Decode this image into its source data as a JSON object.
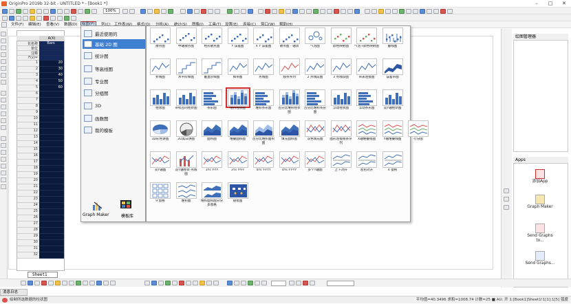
{
  "window": {
    "title": "OriginPro 2019b 32-bit - UNTITLED * - [Book1 *]"
  },
  "toolbar": {
    "zoom_value": "100%"
  },
  "menubar": {
    "items": [
      "文件(F)",
      "编辑(E)",
      "查看(V)",
      "数据(D)",
      "绘图(P)",
      "列(C)",
      "工作表(W)",
      "格式(O)",
      "分析(A)",
      "统计(S)",
      "图像(I)",
      "工具(T)",
      "设置(E)",
      "连接(C)",
      "窗口(W)",
      "帮助(H)"
    ]
  },
  "book": {
    "col_header": "A(X)",
    "row_labels": [
      "长名称",
      "单位",
      "注释",
      "F(x)="
    ],
    "first_cell": "Bars",
    "row_numbers": [
      "1",
      "2",
      "3",
      "4",
      "5",
      "6",
      "7",
      "8",
      "9",
      "10",
      "11",
      "12",
      "13",
      "14",
      "15",
      "16",
      "17",
      "18",
      "19",
      "20",
      "21",
      "22",
      "23",
      "24",
      "25",
      "26",
      "27",
      "28",
      "29",
      "30",
      "31",
      "32"
    ],
    "values": [
      "20",
      "30",
      "40",
      "50",
      "60"
    ]
  },
  "plot_menu": {
    "categories": [
      "最近使用的",
      "基础 2D 图",
      "统计图",
      "等高线图",
      "专业图",
      "分组图",
      "3D",
      "函数图",
      "我的模板"
    ],
    "selected": "基础 2D 图",
    "bottom": {
      "graph_maker": "Graph Maker",
      "templates": "模板库"
    }
  },
  "gallery": {
    "rows": [
      [
        "散点图",
        "中轴散点图",
        "柱形散点图",
        "Y 误差图",
        "X Y 误差图",
        "散点图 - 轴须",
        "气泡图",
        "颜色映射图",
        "气泡+颜色映射图",
        "垂线图"
      ],
      [
        "折线图",
        "水平阶梯图",
        "垂直阶梯图",
        "样条图",
        "点线图",
        "线条序列",
        "2 点线段图",
        "3 点线段图",
        "带表连接图",
        "误差带图"
      ],
      [
        "柱状图",
        "带标签的柱状图",
        "条形图",
        "堆积柱状图",
        "堆积条形图",
        "百分比堆积柱状图",
        "百分比堆积条形图",
        "浮动柱状图",
        "浮动条形图",
        "双Y轴柱状图"
      ],
      [
        "3D彩色饼图",
        "2D黑白饼图",
        "面积图",
        "堆叠面积图",
        "百分比堆积面积图",
        "填充面积图",
        "双色填充图",
        "图形连接线条序列",
        "X轴堆叠线图",
        "Y轴堆叠线图",
        "行分图"
      ],
      [
        "双Y轴图",
        "双Y轴柱状-点线图",
        "3Ys Y-YY",
        "3Ys Y-Y-Y",
        "4Ys Y-YYY",
        "4Ys YY-YY",
        "多个Y轴图",
        "上下对开",
        "左右对开",
        "4 窗格"
      ],
      [
        "9 窗格",
        "堆积图",
        "堆积面积图分分多窗格",
        "随批图"
      ]
    ],
    "highlighted": "堆积柱状图"
  },
  "right_panel": {
    "title1": "绘图管理器",
    "title2": "Apps",
    "apps": [
      "添加App",
      "Graph Maker",
      "Send Graphs to...",
      "Send Graphs..."
    ]
  },
  "sheet_tab": "Sheet1",
  "message_tab": "消息日志",
  "status": {
    "left": "绘制所选数据的柱状图",
    "right": "平均值=40.3496 求和=1008.74 计数=25 ■ AU: 开 1:[Book1]Sheet1!1[1]:1[5] 弧度"
  },
  "colors": {
    "accent": "#3f7fd0",
    "highlight": "#d42c2c",
    "sheet_bg": "#0a1a3a"
  }
}
